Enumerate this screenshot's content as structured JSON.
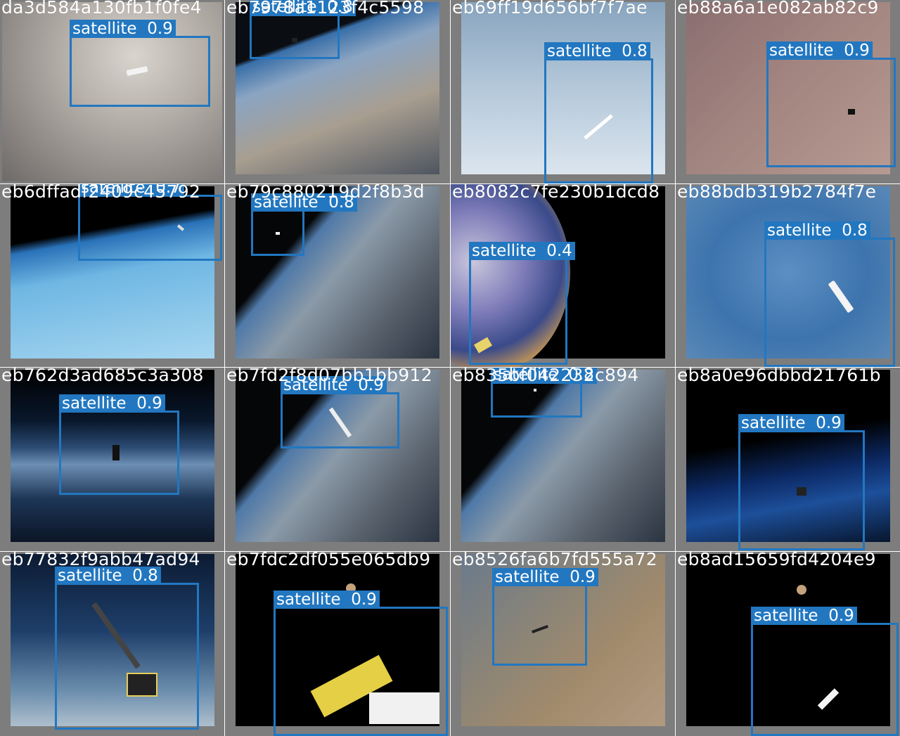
{
  "class_label": "satellite",
  "box_color": "#2277c0",
  "tiles": [
    {
      "filename": "da3d584a130fb1f0fe4",
      "conf": "0.9"
    },
    {
      "filename": "eb7978a1123f4c5598",
      "conf": "0.8"
    },
    {
      "filename": "eb69ff19d656bf7f7ae",
      "conf": "0.8"
    },
    {
      "filename": "eb88a6a1e082ab82c9",
      "conf": "0.9"
    },
    {
      "filename": "eb6dffadf2409c45792",
      "conf": "0.7"
    },
    {
      "filename": "eb79c880219d2f8b3d",
      "conf": "0.8"
    },
    {
      "filename": "eb8082c7fe230b1dcd8",
      "conf": "0.4"
    },
    {
      "filename": "eb88bdb319b2784f7e",
      "conf": "0.8"
    },
    {
      "filename": "eb762d3ad685c3a308",
      "conf": "0.9"
    },
    {
      "filename": "eb7fd2f8d07bb1bb912",
      "conf": "0.9"
    },
    {
      "filename": "eb835bf042232c894",
      "conf": "0.8"
    },
    {
      "filename": "eb8a0e96dbbd21761b",
      "conf": "0.9"
    },
    {
      "filename": "eb77832f9abb47ad94",
      "conf": "0.8"
    },
    {
      "filename": "eb7fdc2df055e065db9",
      "conf": "0.9"
    },
    {
      "filename": "eb8526fa6b7fd555a72",
      "conf": "0.9"
    },
    {
      "filename": "eb8ad15659fd4204e9",
      "conf": "0.9"
    }
  ]
}
